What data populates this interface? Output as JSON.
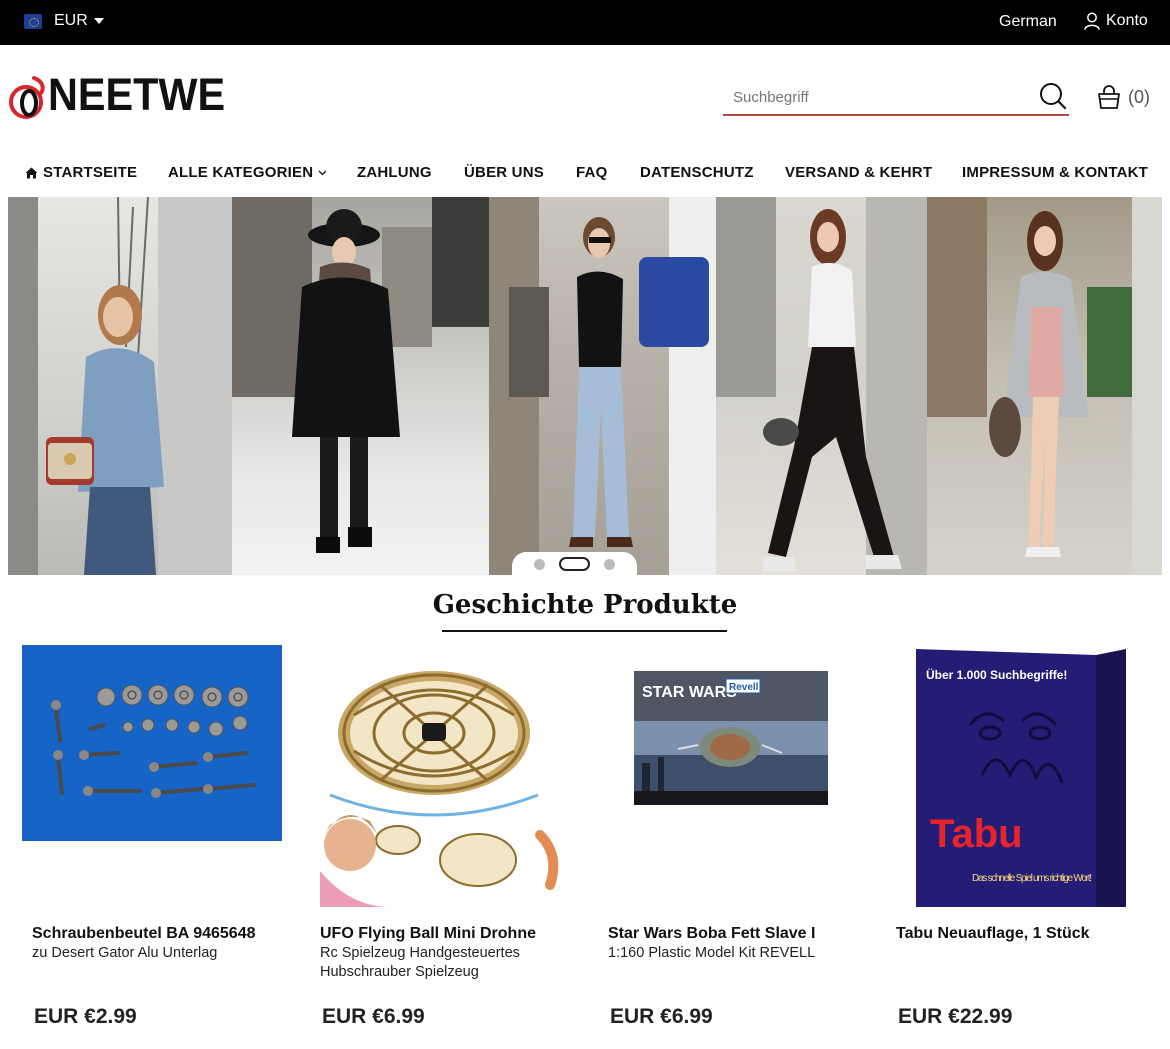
{
  "topbar": {
    "currency": "EUR",
    "language": "German",
    "account": "Konto"
  },
  "header": {
    "logo_text": "NEETWE",
    "logo_mark": "O",
    "search_placeholder": "Suchbegriff",
    "cart_count": "(0)"
  },
  "nav": {
    "items": [
      {
        "label": "STARTSEITE"
      },
      {
        "label": "ALLE KATEGORIEN"
      },
      {
        "label": "ZAHLUNG"
      },
      {
        "label": "ÜBER UNS"
      },
      {
        "label": "FAQ"
      },
      {
        "label": "DATENSCHUTZ"
      },
      {
        "label": "VERSAND & KEHRT"
      },
      {
        "label": "IMPRESSUM & KONTAKT"
      }
    ]
  },
  "banner": {
    "slide_count": 3,
    "active_slide": 2
  },
  "section": {
    "title": "Geschichte Produkte"
  },
  "products": [
    {
      "name": "Schraubenbeutel BA 9465648",
      "desc": "zu Desert Gator Alu Unterlag",
      "price": "EUR €2.99"
    },
    {
      "name": "UFO Flying Ball Mini Drohne",
      "desc": "Rc Spielzeug Handgesteuertes Hubschrauber Spielzeug",
      "price": "EUR €6.99"
    },
    {
      "name": "Star Wars Boba Fett Slave I",
      "desc": "1:160 Plastic Model Kit REVELL",
      "price": "EUR €6.99"
    },
    {
      "name": "Tabu Neuauflage, 1 Stück",
      "desc": "",
      "price": "EUR €22.99"
    }
  ],
  "product_images": {
    "p3_box_brand": "STAR WARS",
    "p3_box_maker": "Revell",
    "p4_box_tagline": "Über 1.000 Suchbegriffe!",
    "p4_box_logo": "Tabu",
    "p4_box_slogan": "Das schnelle Spiel ums richtige Wort!"
  },
  "colors": {
    "topbar_bg": "#000000",
    "accent_red": "#d8262c",
    "search_underline": "#b14a3a"
  }
}
